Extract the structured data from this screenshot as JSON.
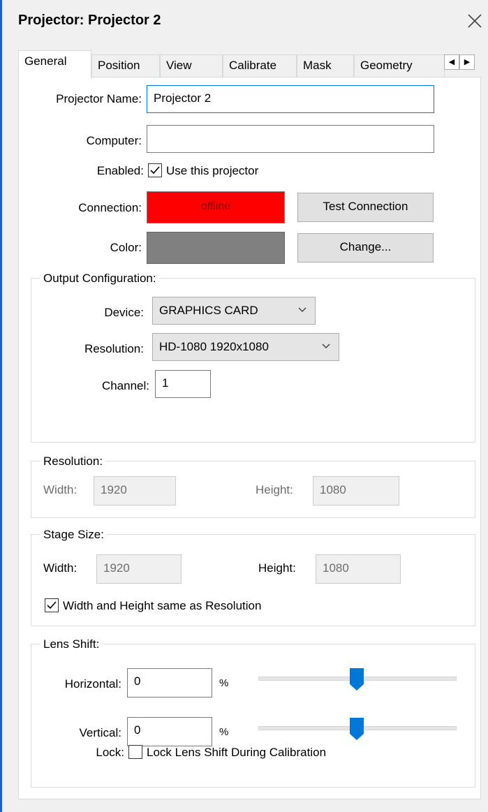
{
  "window": {
    "title": "Projector: Projector 2"
  },
  "tabs": [
    "General",
    "Position",
    "View",
    "Calibrate",
    "Mask",
    "Geometry"
  ],
  "general": {
    "projector_name_label": "Projector Name:",
    "projector_name_value": "Projector 2",
    "computer_label": "Computer:",
    "computer_value": "",
    "enabled_label": "Enabled:",
    "enabled_checkbox_label": "Use this projector",
    "enabled_checked": true,
    "connection_label": "Connection:",
    "connection_status": "offline",
    "connection_color": "#ff0000",
    "test_connection_button": "Test Connection",
    "color_label": "Color:",
    "color_swatch": "#808080",
    "change_button": "Change..."
  },
  "output_config": {
    "title": "Output Configuration:",
    "device_label": "Device:",
    "device_value": "GRAPHICS CARD",
    "resolution_label": "Resolution:",
    "resolution_value": "HD-1080 1920x1080",
    "channel_label": "Channel:",
    "channel_value": "1"
  },
  "resolution": {
    "title": "Resolution:",
    "width_label": "Width:",
    "width_value": "1920",
    "height_label": "Height:",
    "height_value": "1080"
  },
  "stage_size": {
    "title": "Stage Size:",
    "width_label": "Width:",
    "width_value": "1920",
    "height_label": "Height:",
    "height_value": "1080",
    "same_as_resolution_label": "Width and Height same as Resolution",
    "same_as_resolution_checked": true
  },
  "lens_shift": {
    "title": "Lens Shift:",
    "horizontal_label": "Horizontal:",
    "horizontal_value": "0",
    "horizontal_unit": "%",
    "vertical_label": "Vertical:",
    "vertical_value": "0",
    "vertical_unit": "%",
    "lock_label": "Lock:",
    "lock_checkbox_label": "Lock Lens Shift During Calibration",
    "lock_checked": false
  },
  "colors": {
    "accent": "#0078d7",
    "window_border": "#1f5fd6"
  }
}
